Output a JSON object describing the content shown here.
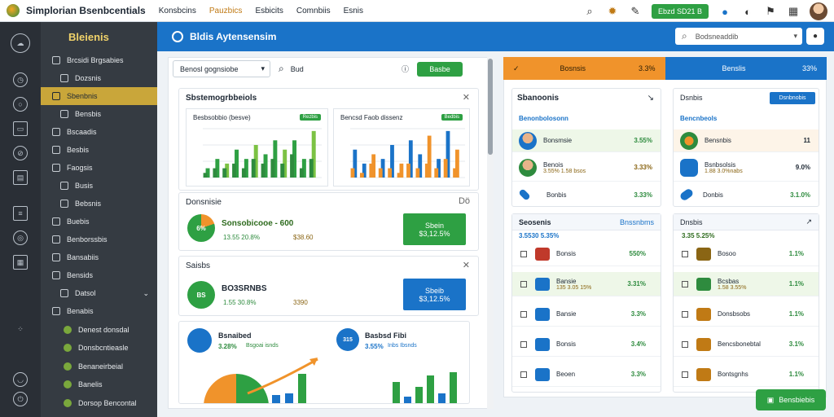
{
  "app": {
    "title": "Simplorian Bsenbcentials",
    "nav": [
      "Konsbcins",
      "Pauzbics",
      "Esbicits",
      "Comnbiis",
      "Esnis"
    ],
    "top_button": "Ebzd SD21 B"
  },
  "sidebar": {
    "brand": "Bleienis",
    "items": [
      {
        "label": "Brcsidi Brgsabies",
        "type": "item"
      },
      {
        "label": "Dozsnis",
        "type": "sub"
      },
      {
        "label": "Sbenbnis",
        "type": "active"
      },
      {
        "label": "Bensbis",
        "type": "sub"
      },
      {
        "label": "Bscaadis",
        "type": "item"
      },
      {
        "label": "Besbis",
        "type": "item"
      },
      {
        "label": "Faogsis",
        "type": "item"
      },
      {
        "label": "Busis",
        "type": "sub"
      },
      {
        "label": "Bebsnis",
        "type": "sub"
      },
      {
        "label": "Buebis",
        "type": "item"
      },
      {
        "label": "Benborssbis",
        "type": "item"
      },
      {
        "label": "Bansabiis",
        "type": "item"
      },
      {
        "label": "Bensids",
        "type": "item"
      },
      {
        "label": "Datsol",
        "type": "sub"
      },
      {
        "label": "Benabis",
        "type": "item"
      },
      {
        "label": "Denest donsdal",
        "type": "dot"
      },
      {
        "label": "Donsbcntieasle",
        "type": "dot"
      },
      {
        "label": "Benaneirbeial",
        "type": "dot"
      },
      {
        "label": "Banelis",
        "type": "dot"
      },
      {
        "label": "Dorsop Bencontal",
        "type": "dot"
      }
    ]
  },
  "header": {
    "title": "Bldis Aytensensim",
    "search_placeholder": "Bodsneaddib"
  },
  "filter": {
    "select": "Benosl gognsiobe",
    "search": "Bud",
    "button": "Basbe"
  },
  "overview": {
    "title": "Sbstemogrbbeiols",
    "chart_left": {
      "title": "Besbsobbio (besve)",
      "badge": "Rezbis"
    },
    "chart_right": {
      "title": "Bencsd Faob dissenz",
      "badge": "Bedbis"
    }
  },
  "card_dominate": {
    "title": "Donsnisie",
    "donut": "6%",
    "headline": "Sonsobicooe - 600",
    "sub1": "13.55 20.8%",
    "sub2": "$38.60",
    "button_top": "Sbein",
    "button_bottom": "$3,12.5%",
    "action": "Dö"
  },
  "card_sales": {
    "title": "Saisbs",
    "donut": "BS",
    "headline": "BO3SRNBS",
    "sub1": "1.55 30.8%",
    "sub2": "3390",
    "button_top": "Sbeib",
    "button_bottom": "$3,12.5%"
  },
  "card_growth": {
    "left_title": "Bsnaibed",
    "left_value": "3.28%",
    "left_badge": "Bsgoai isnds",
    "right_title": "Basbsd Fibi",
    "right_value": "3.55%",
    "right_badge": "Inbs Ibsnds",
    "right_donut": "315"
  },
  "tabs": [
    {
      "label": "Bosnsis",
      "pct": "3.3%"
    },
    {
      "label": "Benslis",
      "pct": "33%"
    }
  ],
  "rank_left": {
    "title": "Sbanoonis",
    "sub": "Benonbolosonn",
    "rows": [
      {
        "name": "Bonsmsie",
        "value": "3.55%"
      },
      {
        "name": "Benois",
        "sub": "3.55% 1.58 bsos",
        "value": "3.33%"
      },
      {
        "name": "Bonbis",
        "value": "3.33%"
      }
    ]
  },
  "rank_right": {
    "title": "Dsnbis",
    "button": "Dsnbnobis",
    "sub": "Bencnbeols",
    "rows": [
      {
        "name": "Bensnbis",
        "value": "11"
      },
      {
        "name": "Bsnbsolsis",
        "sub": "1.88 3.0%nabs",
        "value": "9.0%"
      },
      {
        "name": "Donbis",
        "value": "3.1.0%"
      }
    ]
  },
  "orders_left": {
    "title": "Seosenis",
    "head_right": "Bnssnbms",
    "sub": "3.5530 5.35%",
    "rows": [
      {
        "name": "Bonsis",
        "sub": "",
        "value": "550%"
      },
      {
        "name": "Bansie",
        "sub": "135 3.05 15%",
        "value": "3.31%"
      },
      {
        "name": "Bansie",
        "sub": "",
        "value": "3.3%"
      },
      {
        "name": "Bonsis",
        "sub": "",
        "value": "3.4%"
      },
      {
        "name": "Beoen",
        "sub": "",
        "value": "3.3%"
      }
    ]
  },
  "orders_right": {
    "title": "Dnsbis",
    "sub": "3.35 5.25%",
    "rows": [
      {
        "name": "Bosoo",
        "sub": "",
        "value": "1.1%"
      },
      {
        "name": "Bcsbas",
        "sub": "1.58 3.55%",
        "value": "1.1%"
      },
      {
        "name": "Donsbsobs",
        "sub": "",
        "value": "1.1%"
      },
      {
        "name": "Bencsbonebtal",
        "sub": "",
        "value": "3.1%"
      },
      {
        "name": "Bontsgnhs",
        "sub": "",
        "value": "1.1%"
      }
    ]
  },
  "float_button": "Bensbiebis",
  "chart_data": [
    {
      "type": "bar",
      "series": [
        {
          "name": "",
          "values": [
            2,
            4,
            3,
            6,
            4,
            7,
            5,
            8,
            6,
            8,
            4,
            10
          ]
        },
        {
          "name": "",
          "values": [
            1,
            2,
            2,
            3,
            2,
            4,
            3,
            4,
            3,
            5,
            2,
            4
          ]
        }
      ]
    },
    {
      "type": "bar",
      "series": [
        {
          "name": "",
          "values": [
            6,
            3,
            5,
            4,
            7,
            3,
            8,
            5,
            9,
            4,
            10,
            6
          ]
        },
        {
          "name": "",
          "values": [
            2,
            1,
            3,
            2,
            2,
            1,
            3,
            2,
            3,
            2,
            4,
            2
          ]
        }
      ]
    }
  ],
  "colors": {
    "green": "#2ea043",
    "blue": "#1a73c8",
    "orange": "#f0932b",
    "gold": "#c9a63a"
  }
}
